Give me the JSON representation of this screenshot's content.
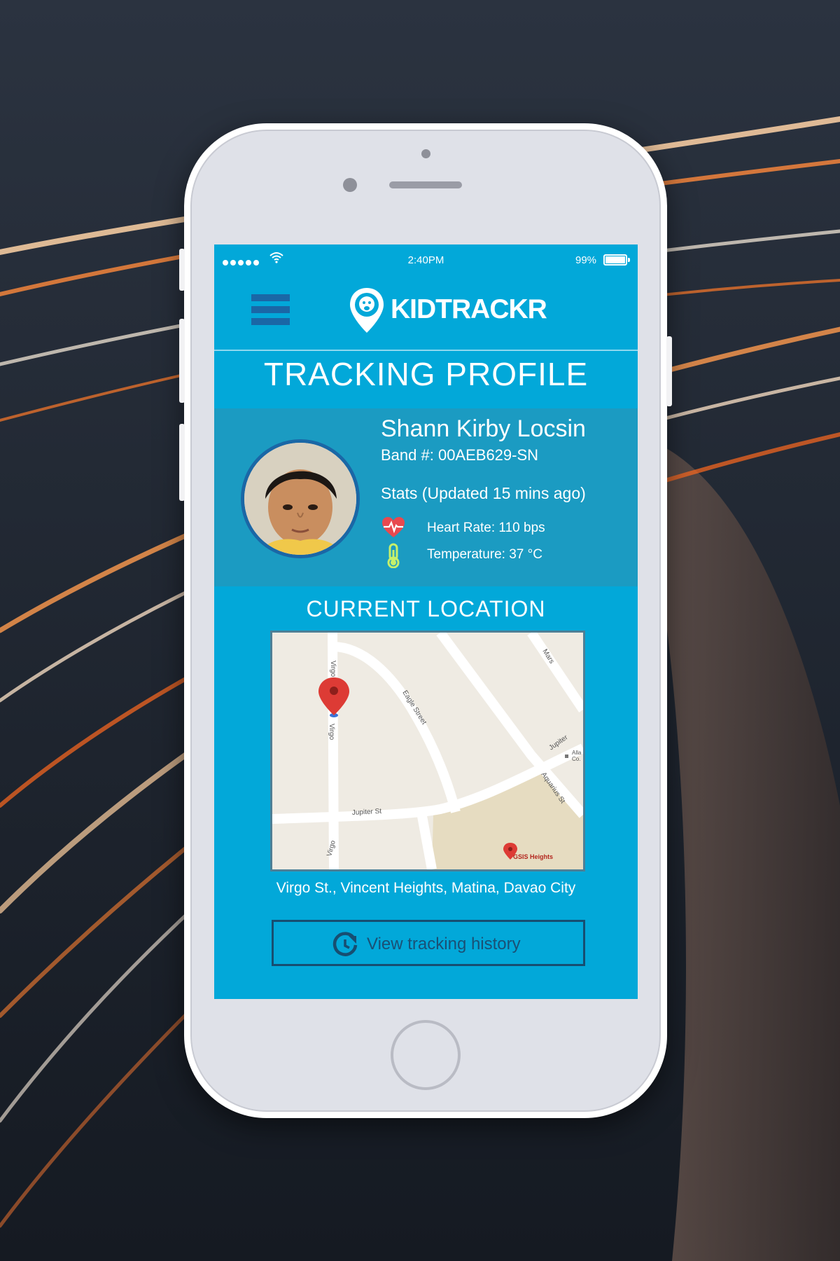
{
  "status_bar": {
    "time": "2:40PM",
    "battery": "99%"
  },
  "app": {
    "name": "KIDTRACKR"
  },
  "page_title": "TRACKING PROFILE",
  "profile": {
    "name": "Shann Kirby Locsin",
    "band": "Band #: 00AEB629-SN",
    "stats_heading": "Stats (Updated 15 mins ago)",
    "heart_rate": "Heart Rate: 110 bps",
    "temperature": "Temperature: 37 °C"
  },
  "location": {
    "title": "CURRENT LOCATION",
    "address": "Virgo St., Vincent Heights, Matina, Davao City",
    "map_labels": {
      "virgo_top": "Virgo",
      "virgo_mid": "Virgo",
      "virgo_bottom": "Virgo",
      "eagle": "Eagle Street",
      "mars": "Mars",
      "jupiter": "Jupiter",
      "jupiter_st": "Jupiter St",
      "aquarius": "Aquarius St",
      "alla": "Alla",
      "co": "Co.",
      "gsis": "GSIS Heights"
    }
  },
  "history_button": {
    "label": "View tracking history"
  },
  "colors": {
    "screen": "#02a8d9",
    "profile_panel": "#1b9bc2",
    "menu_icon": "#1a67a6",
    "heart": "#e8494f",
    "thermometer": "#c6f06a"
  },
  "icons": [
    "menu-icon",
    "kidtrackr-logo-pin-icon",
    "wifi-icon",
    "battery-icon",
    "heart-rate-icon",
    "thermometer-icon",
    "map-pin-icon",
    "history-refresh-icon"
  ]
}
